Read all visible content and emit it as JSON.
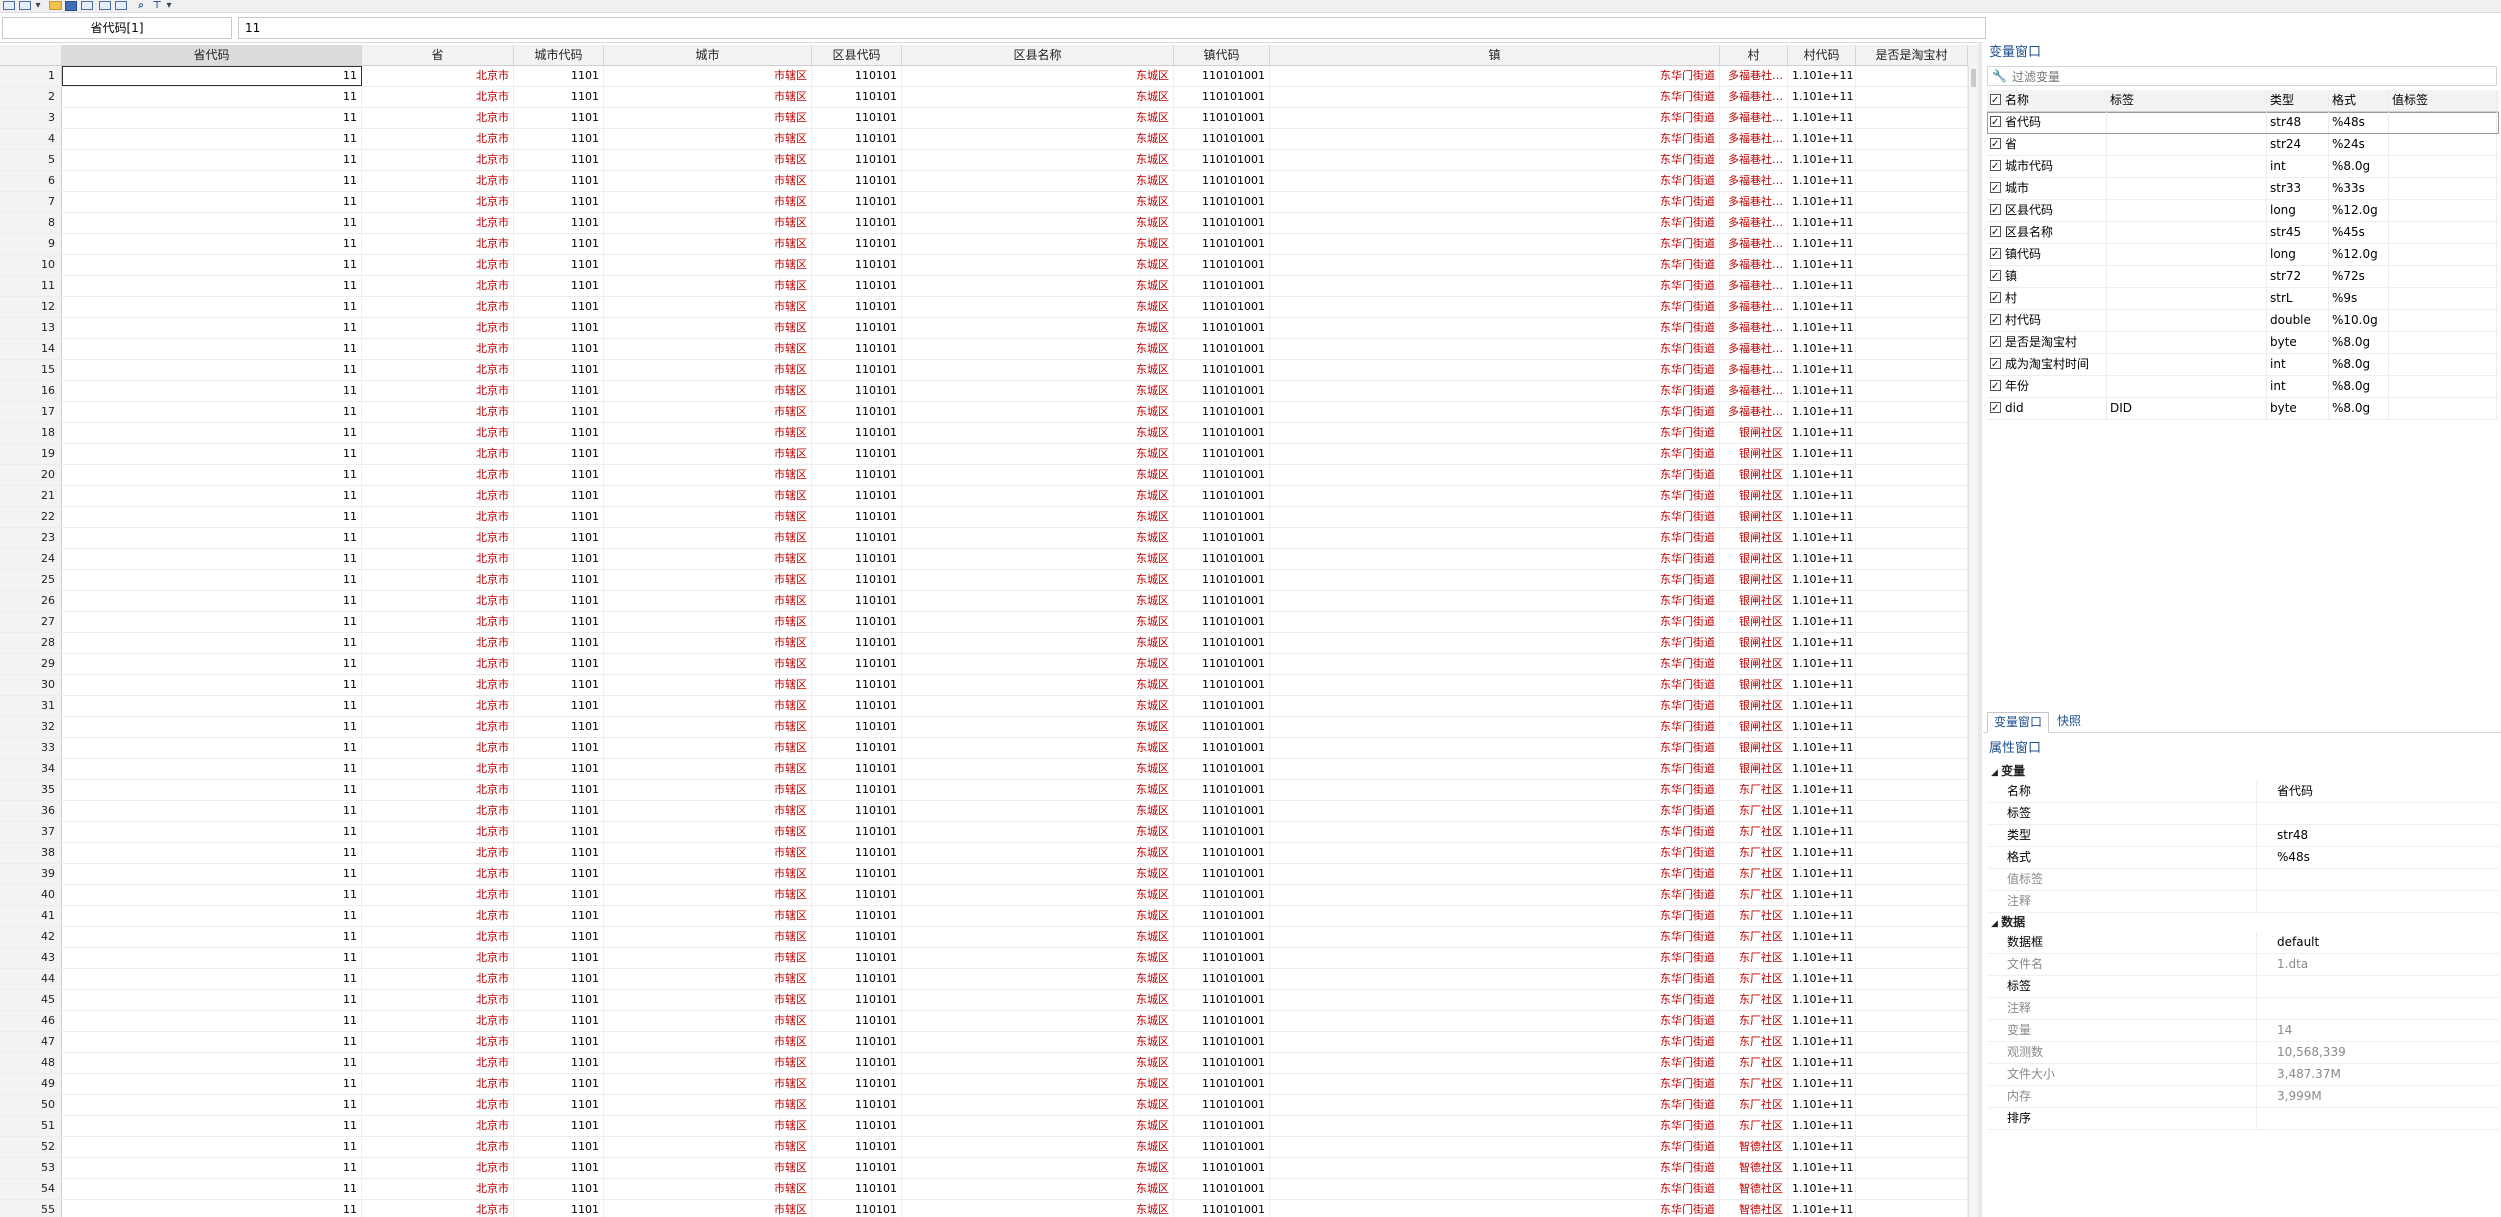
{
  "toolbar": {
    "icons": [
      "data-editor-icon",
      "dropdown-arrow-icon",
      "open-folder-icon",
      "save-icon",
      "print-icon",
      "copy-icon",
      "paste-icon",
      "search-icon",
      "filter-icon",
      "dropdown-arrow-icon"
    ]
  },
  "editbar": {
    "cell_ref": "省代码[1]",
    "value": "11"
  },
  "grid": {
    "columns": [
      "省代码",
      "省",
      "城市代码",
      "城市",
      "区县代码",
      "区县名称",
      "镇代码",
      "镇",
      "村",
      "村代码",
      "是否是淘宝村"
    ],
    "rows": [
      [
        "1",
        "11",
        "北京市",
        "1101",
        "市辖区",
        "110101",
        "东城区",
        "110101001",
        "东华门街道",
        "多福巷社…",
        "1.101e+11",
        ""
      ],
      [
        "2",
        "11",
        "北京市",
        "1101",
        "市辖区",
        "110101",
        "东城区",
        "110101001",
        "东华门街道",
        "多福巷社…",
        "1.101e+11",
        ""
      ],
      [
        "3",
        "11",
        "北京市",
        "1101",
        "市辖区",
        "110101",
        "东城区",
        "110101001",
        "东华门街道",
        "多福巷社…",
        "1.101e+11",
        ""
      ],
      [
        "4",
        "11",
        "北京市",
        "1101",
        "市辖区",
        "110101",
        "东城区",
        "110101001",
        "东华门街道",
        "多福巷社…",
        "1.101e+11",
        ""
      ],
      [
        "5",
        "11",
        "北京市",
        "1101",
        "市辖区",
        "110101",
        "东城区",
        "110101001",
        "东华门街道",
        "多福巷社…",
        "1.101e+11",
        ""
      ],
      [
        "6",
        "11",
        "北京市",
        "1101",
        "市辖区",
        "110101",
        "东城区",
        "110101001",
        "东华门街道",
        "多福巷社…",
        "1.101e+11",
        ""
      ],
      [
        "7",
        "11",
        "北京市",
        "1101",
        "市辖区",
        "110101",
        "东城区",
        "110101001",
        "东华门街道",
        "多福巷社…",
        "1.101e+11",
        ""
      ],
      [
        "8",
        "11",
        "北京市",
        "1101",
        "市辖区",
        "110101",
        "东城区",
        "110101001",
        "东华门街道",
        "多福巷社…",
        "1.101e+11",
        ""
      ],
      [
        "9",
        "11",
        "北京市",
        "1101",
        "市辖区",
        "110101",
        "东城区",
        "110101001",
        "东华门街道",
        "多福巷社…",
        "1.101e+11",
        ""
      ],
      [
        "10",
        "11",
        "北京市",
        "1101",
        "市辖区",
        "110101",
        "东城区",
        "110101001",
        "东华门街道",
        "多福巷社…",
        "1.101e+11",
        ""
      ],
      [
        "11",
        "11",
        "北京市",
        "1101",
        "市辖区",
        "110101",
        "东城区",
        "110101001",
        "东华门街道",
        "多福巷社…",
        "1.101e+11",
        ""
      ],
      [
        "12",
        "11",
        "北京市",
        "1101",
        "市辖区",
        "110101",
        "东城区",
        "110101001",
        "东华门街道",
        "多福巷社…",
        "1.101e+11",
        ""
      ],
      [
        "13",
        "11",
        "北京市",
        "1101",
        "市辖区",
        "110101",
        "东城区",
        "110101001",
        "东华门街道",
        "多福巷社…",
        "1.101e+11",
        ""
      ],
      [
        "14",
        "11",
        "北京市",
        "1101",
        "市辖区",
        "110101",
        "东城区",
        "110101001",
        "东华门街道",
        "多福巷社…",
        "1.101e+11",
        ""
      ],
      [
        "15",
        "11",
        "北京市",
        "1101",
        "市辖区",
        "110101",
        "东城区",
        "110101001",
        "东华门街道",
        "多福巷社…",
        "1.101e+11",
        ""
      ],
      [
        "16",
        "11",
        "北京市",
        "1101",
        "市辖区",
        "110101",
        "东城区",
        "110101001",
        "东华门街道",
        "多福巷社…",
        "1.101e+11",
        ""
      ],
      [
        "17",
        "11",
        "北京市",
        "1101",
        "市辖区",
        "110101",
        "东城区",
        "110101001",
        "东华门街道",
        "多福巷社…",
        "1.101e+11",
        ""
      ],
      [
        "18",
        "11",
        "北京市",
        "1101",
        "市辖区",
        "110101",
        "东城区",
        "110101001",
        "东华门街道",
        "银闸社区",
        "1.101e+11",
        ""
      ],
      [
        "19",
        "11",
        "北京市",
        "1101",
        "市辖区",
        "110101",
        "东城区",
        "110101001",
        "东华门街道",
        "银闸社区",
        "1.101e+11",
        ""
      ],
      [
        "20",
        "11",
        "北京市",
        "1101",
        "市辖区",
        "110101",
        "东城区",
        "110101001",
        "东华门街道",
        "银闸社区",
        "1.101e+11",
        ""
      ],
      [
        "21",
        "11",
        "北京市",
        "1101",
        "市辖区",
        "110101",
        "东城区",
        "110101001",
        "东华门街道",
        "银闸社区",
        "1.101e+11",
        ""
      ],
      [
        "22",
        "11",
        "北京市",
        "1101",
        "市辖区",
        "110101",
        "东城区",
        "110101001",
        "东华门街道",
        "银闸社区",
        "1.101e+11",
        ""
      ],
      [
        "23",
        "11",
        "北京市",
        "1101",
        "市辖区",
        "110101",
        "东城区",
        "110101001",
        "东华门街道",
        "银闸社区",
        "1.101e+11",
        ""
      ],
      [
        "24",
        "11",
        "北京市",
        "1101",
        "市辖区",
        "110101",
        "东城区",
        "110101001",
        "东华门街道",
        "银闸社区",
        "1.101e+11",
        ""
      ],
      [
        "25",
        "11",
        "北京市",
        "1101",
        "市辖区",
        "110101",
        "东城区",
        "110101001",
        "东华门街道",
        "银闸社区",
        "1.101e+11",
        ""
      ],
      [
        "26",
        "11",
        "北京市",
        "1101",
        "市辖区",
        "110101",
        "东城区",
        "110101001",
        "东华门街道",
        "银闸社区",
        "1.101e+11",
        ""
      ],
      [
        "27",
        "11",
        "北京市",
        "1101",
        "市辖区",
        "110101",
        "东城区",
        "110101001",
        "东华门街道",
        "银闸社区",
        "1.101e+11",
        ""
      ],
      [
        "28",
        "11",
        "北京市",
        "1101",
        "市辖区",
        "110101",
        "东城区",
        "110101001",
        "东华门街道",
        "银闸社区",
        "1.101e+11",
        ""
      ],
      [
        "29",
        "11",
        "北京市",
        "1101",
        "市辖区",
        "110101",
        "东城区",
        "110101001",
        "东华门街道",
        "银闸社区",
        "1.101e+11",
        ""
      ],
      [
        "30",
        "11",
        "北京市",
        "1101",
        "市辖区",
        "110101",
        "东城区",
        "110101001",
        "东华门街道",
        "银闸社区",
        "1.101e+11",
        ""
      ],
      [
        "31",
        "11",
        "北京市",
        "1101",
        "市辖区",
        "110101",
        "东城区",
        "110101001",
        "东华门街道",
        "银闸社区",
        "1.101e+11",
        ""
      ],
      [
        "32",
        "11",
        "北京市",
        "1101",
        "市辖区",
        "110101",
        "东城区",
        "110101001",
        "东华门街道",
        "银闸社区",
        "1.101e+11",
        ""
      ],
      [
        "33",
        "11",
        "北京市",
        "1101",
        "市辖区",
        "110101",
        "东城区",
        "110101001",
        "东华门街道",
        "银闸社区",
        "1.101e+11",
        ""
      ],
      [
        "34",
        "11",
        "北京市",
        "1101",
        "市辖区",
        "110101",
        "东城区",
        "110101001",
        "东华门街道",
        "银闸社区",
        "1.101e+11",
        ""
      ],
      [
        "35",
        "11",
        "北京市",
        "1101",
        "市辖区",
        "110101",
        "东城区",
        "110101001",
        "东华门街道",
        "东厂社区",
        "1.101e+11",
        ""
      ],
      [
        "36",
        "11",
        "北京市",
        "1101",
        "市辖区",
        "110101",
        "东城区",
        "110101001",
        "东华门街道",
        "东厂社区",
        "1.101e+11",
        ""
      ],
      [
        "37",
        "11",
        "北京市",
        "1101",
        "市辖区",
        "110101",
        "东城区",
        "110101001",
        "东华门街道",
        "东厂社区",
        "1.101e+11",
        ""
      ],
      [
        "38",
        "11",
        "北京市",
        "1101",
        "市辖区",
        "110101",
        "东城区",
        "110101001",
        "东华门街道",
        "东厂社区",
        "1.101e+11",
        ""
      ],
      [
        "39",
        "11",
        "北京市",
        "1101",
        "市辖区",
        "110101",
        "东城区",
        "110101001",
        "东华门街道",
        "东厂社区",
        "1.101e+11",
        ""
      ],
      [
        "40",
        "11",
        "北京市",
        "1101",
        "市辖区",
        "110101",
        "东城区",
        "110101001",
        "东华门街道",
        "东厂社区",
        "1.101e+11",
        ""
      ],
      [
        "41",
        "11",
        "北京市",
        "1101",
        "市辖区",
        "110101",
        "东城区",
        "110101001",
        "东华门街道",
        "东厂社区",
        "1.101e+11",
        ""
      ],
      [
        "42",
        "11",
        "北京市",
        "1101",
        "市辖区",
        "110101",
        "东城区",
        "110101001",
        "东华门街道",
        "东厂社区",
        "1.101e+11",
        ""
      ],
      [
        "43",
        "11",
        "北京市",
        "1101",
        "市辖区",
        "110101",
        "东城区",
        "110101001",
        "东华门街道",
        "东厂社区",
        "1.101e+11",
        ""
      ],
      [
        "44",
        "11",
        "北京市",
        "1101",
        "市辖区",
        "110101",
        "东城区",
        "110101001",
        "东华门街道",
        "东厂社区",
        "1.101e+11",
        ""
      ],
      [
        "45",
        "11",
        "北京市",
        "1101",
        "市辖区",
        "110101",
        "东城区",
        "110101001",
        "东华门街道",
        "东厂社区",
        "1.101e+11",
        ""
      ],
      [
        "46",
        "11",
        "北京市",
        "1101",
        "市辖区",
        "110101",
        "东城区",
        "110101001",
        "东华门街道",
        "东厂社区",
        "1.101e+11",
        ""
      ],
      [
        "47",
        "11",
        "北京市",
        "1101",
        "市辖区",
        "110101",
        "东城区",
        "110101001",
        "东华门街道",
        "东厂社区",
        "1.101e+11",
        ""
      ],
      [
        "48",
        "11",
        "北京市",
        "1101",
        "市辖区",
        "110101",
        "东城区",
        "110101001",
        "东华门街道",
        "东厂社区",
        "1.101e+11",
        ""
      ],
      [
        "49",
        "11",
        "北京市",
        "1101",
        "市辖区",
        "110101",
        "东城区",
        "110101001",
        "东华门街道",
        "东厂社区",
        "1.101e+11",
        ""
      ],
      [
        "50",
        "11",
        "北京市",
        "1101",
        "市辖区",
        "110101",
        "东城区",
        "110101001",
        "东华门街道",
        "东厂社区",
        "1.101e+11",
        ""
      ],
      [
        "51",
        "11",
        "北京市",
        "1101",
        "市辖区",
        "110101",
        "东城区",
        "110101001",
        "东华门街道",
        "东厂社区",
        "1.101e+11",
        ""
      ],
      [
        "52",
        "11",
        "北京市",
        "1101",
        "市辖区",
        "110101",
        "东城区",
        "110101001",
        "东华门街道",
        "智德社区",
        "1.101e+11",
        ""
      ],
      [
        "53",
        "11",
        "北京市",
        "1101",
        "市辖区",
        "110101",
        "东城区",
        "110101001",
        "东华门街道",
        "智德社区",
        "1.101e+11",
        ""
      ],
      [
        "54",
        "11",
        "北京市",
        "1101",
        "市辖区",
        "110101",
        "东城区",
        "110101001",
        "东华门街道",
        "智德社区",
        "1.101e+11",
        ""
      ],
      [
        "55",
        "11",
        "北京市",
        "1101",
        "市辖区",
        "110101",
        "东城区",
        "110101001",
        "东华门街道",
        "智德社区",
        "1.101e+11",
        ""
      ]
    ]
  },
  "variables_pane": {
    "title": "变量窗口",
    "filter_placeholder": "过滤变量",
    "headers": [
      "名称",
      "标签",
      "类型",
      "格式",
      "值标签"
    ],
    "rows": [
      {
        "name": "省代码",
        "label": "",
        "type": "str48",
        "format": "%48s",
        "value_label": ""
      },
      {
        "name": "省",
        "label": "",
        "type": "str24",
        "format": "%24s",
        "value_label": ""
      },
      {
        "name": "城市代码",
        "label": "",
        "type": "int",
        "format": "%8.0g",
        "value_label": ""
      },
      {
        "name": "城市",
        "label": "",
        "type": "str33",
        "format": "%33s",
        "value_label": ""
      },
      {
        "name": "区县代码",
        "label": "",
        "type": "long",
        "format": "%12.0g",
        "value_label": ""
      },
      {
        "name": "区县名称",
        "label": "",
        "type": "str45",
        "format": "%45s",
        "value_label": ""
      },
      {
        "name": "镇代码",
        "label": "",
        "type": "long",
        "format": "%12.0g",
        "value_label": ""
      },
      {
        "name": "镇",
        "label": "",
        "type": "str72",
        "format": "%72s",
        "value_label": ""
      },
      {
        "name": "村",
        "label": "",
        "type": "strL",
        "format": "%9s",
        "value_label": ""
      },
      {
        "name": "村代码",
        "label": "",
        "type": "double",
        "format": "%10.0g",
        "value_label": ""
      },
      {
        "name": "是否是淘宝村",
        "label": "",
        "type": "byte",
        "format": "%8.0g",
        "value_label": ""
      },
      {
        "name": "成为淘宝村时间",
        "label": "",
        "type": "int",
        "format": "%8.0g",
        "value_label": ""
      },
      {
        "name": "年份",
        "label": "",
        "type": "int",
        "format": "%8.0g",
        "value_label": ""
      },
      {
        "name": "did",
        "label": "DID",
        "type": "byte",
        "format": "%8.0g",
        "value_label": ""
      }
    ]
  },
  "tabs": [
    "变量窗口",
    "快照"
  ],
  "properties_pane": {
    "title": "属性窗口",
    "sections": [
      {
        "title": "变量",
        "rows": [
          {
            "key": "名称",
            "value": "省代码",
            "dim": false
          },
          {
            "key": "标签",
            "value": "",
            "dim": false
          },
          {
            "key": "类型",
            "value": "str48",
            "dim": false
          },
          {
            "key": "格式",
            "value": "%48s",
            "dim": false
          },
          {
            "key": "值标签",
            "value": "",
            "dim": true
          },
          {
            "key": "注释",
            "value": "",
            "dim": true
          }
        ]
      },
      {
        "title": "数据",
        "rows": [
          {
            "key": "数据框",
            "value": "default",
            "dim": false
          },
          {
            "key": "文件名",
            "value": "1.dta",
            "dim": true
          },
          {
            "key": "标签",
            "value": "",
            "dim": false
          },
          {
            "key": "注释",
            "value": "",
            "dim": true
          },
          {
            "key": "变量",
            "value": "14",
            "dim": true
          },
          {
            "key": "观测数",
            "value": "10,568,339",
            "dim": true
          },
          {
            "key": "文件大小",
            "value": "3,487.37M",
            "dim": true
          },
          {
            "key": "内存",
            "value": "3,999M",
            "dim": true
          },
          {
            "key": "排序",
            "value": "",
            "dim": false
          }
        ]
      }
    ]
  },
  "colors": {
    "string_text": "#c00000",
    "title_blue": "#1f4f8f"
  }
}
